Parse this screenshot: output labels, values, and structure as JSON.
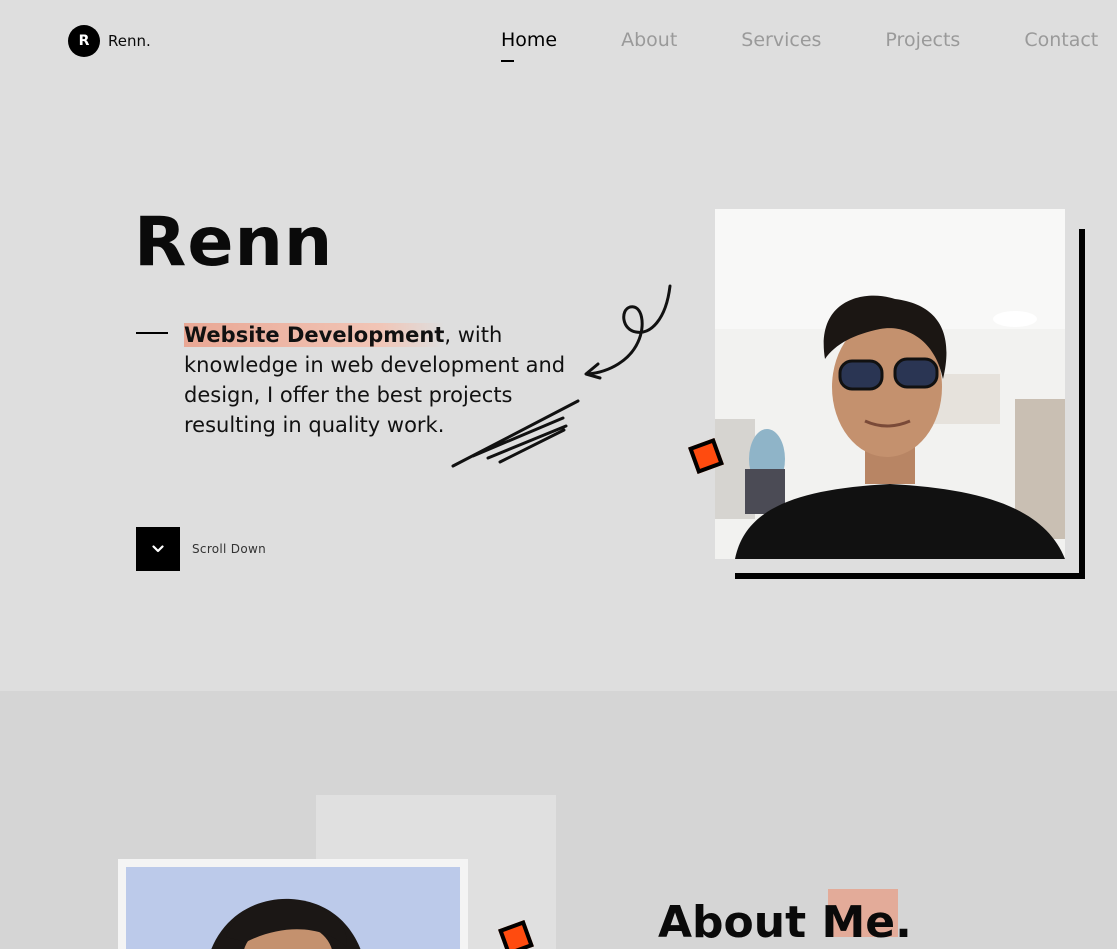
{
  "brand": {
    "initial": "R",
    "name": "Renn."
  },
  "nav": {
    "items": [
      {
        "label": "Home",
        "active": true
      },
      {
        "label": "About",
        "active": false
      },
      {
        "label": "Services",
        "active": false
      },
      {
        "label": "Projects",
        "active": false
      },
      {
        "label": "Contact",
        "active": false
      }
    ]
  },
  "hero": {
    "name": "Renn",
    "highlight": "Website Development",
    "description": ", with knowledge in web development and design, I offer the best projects resulting in quality work.",
    "scroll_label": "Scroll Down",
    "scroll_icon": "chevron-down-icon"
  },
  "about": {
    "title": "About Me."
  },
  "colors": {
    "background": "#dedede",
    "section_background": "#d5d5d5",
    "accent": "#ff4b0f",
    "highlight": "#e9a794",
    "text": "#0a0a0a",
    "nav_inactive": "#9a9a9a"
  }
}
